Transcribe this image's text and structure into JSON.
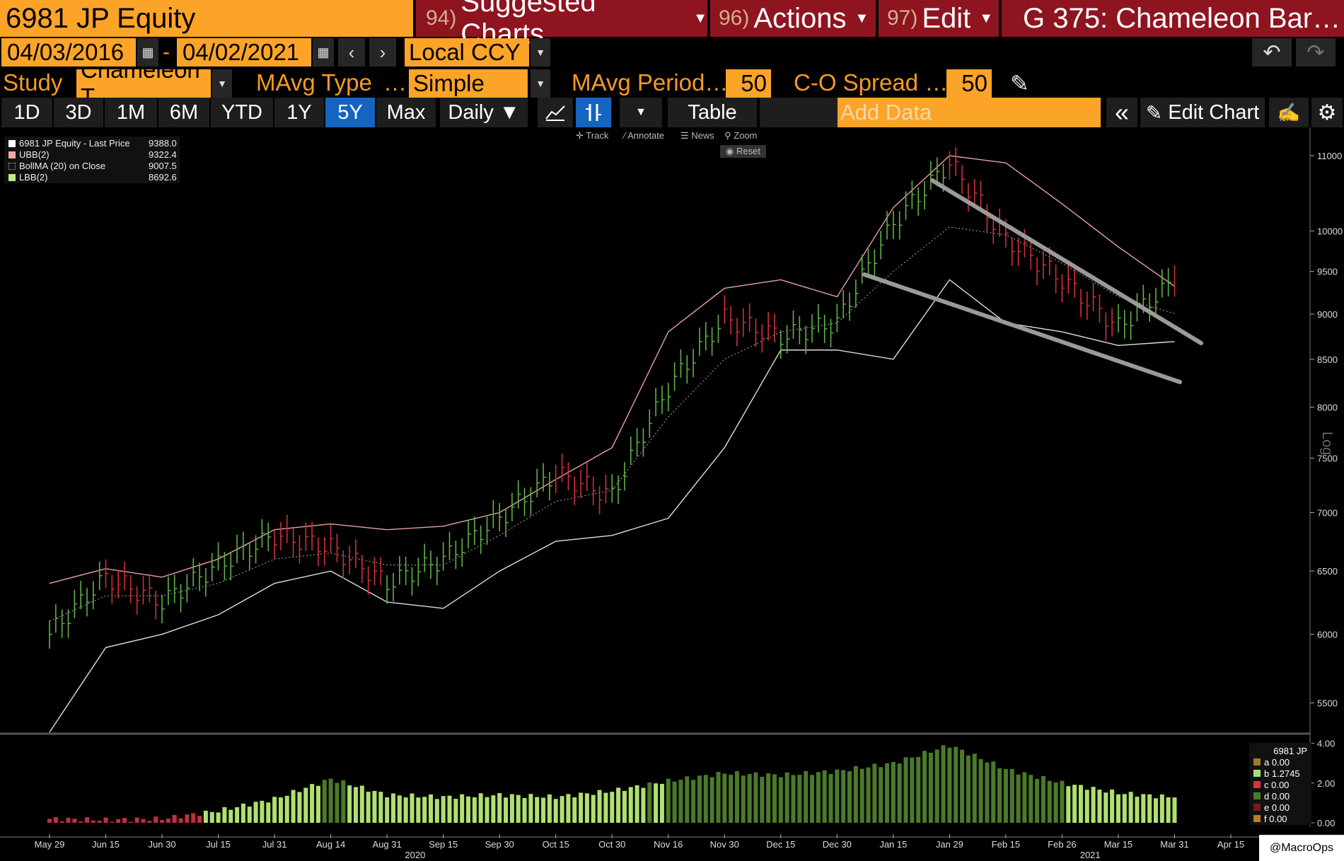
{
  "header": {
    "ticker": "6981 JP Equity",
    "menus": [
      {
        "num": "94)",
        "label": "Suggested Charts"
      },
      {
        "num": "96)",
        "label": "Actions"
      },
      {
        "num": "97)",
        "label": "Edit"
      }
    ],
    "window_title": "G 375: Chameleon Bar…"
  },
  "date_range": {
    "start": "04/03/2016",
    "separator": "-",
    "end": "04/02/2021",
    "currency": "Local CCY"
  },
  "study_bar": {
    "study_label": "Study",
    "study_value": "Chameleon T",
    "mavg_type_label": "MAvg Type",
    "mavg_type_ellipsis": "…",
    "mavg_type_value": "Simple",
    "mavg_period_label": "MAvg Period…",
    "mavg_period_value": "50",
    "co_spread_label": "C-O Spread …",
    "co_spread_value": "50"
  },
  "toolbar": {
    "periods": [
      "1D",
      "3D",
      "1M",
      "6M",
      "YTD",
      "1Y",
      "5Y",
      "Max"
    ],
    "selected_period": "5Y",
    "frequency": "Daily ▼",
    "table_label": "Table",
    "add_data_placeholder": "Add Data",
    "edit_chart_label": "Edit Chart",
    "subtools": [
      "Track",
      "Annotate",
      "News",
      "Zoom"
    ],
    "reset_label": "Reset"
  },
  "legend": [
    {
      "label": "6981 JP Equity - Last Price",
      "value": "9388.0",
      "color": "#ffffff"
    },
    {
      "label": "UBB(2)",
      "value": "9322.4",
      "color": "#f4a6a6"
    },
    {
      "label": "BollMA (20)  on Close",
      "value": "9007.5",
      "color": "#000000"
    },
    {
      "label": "LBB(2)",
      "value": "8692.6",
      "color": "#b4f08c"
    }
  ],
  "lower_legend": {
    "title": "6981 JP",
    "items": [
      {
        "key": "a",
        "value": "0.00",
        "color": "#a0782a"
      },
      {
        "key": "b",
        "value": "1.2745",
        "color": "#a8e070"
      },
      {
        "key": "c",
        "value": "0.00",
        "color": "#e03040"
      },
      {
        "key": "d",
        "value": "0.00",
        "color": "#4a7a2a"
      },
      {
        "key": "e",
        "value": "0.00",
        "color": "#7a1a22"
      },
      {
        "key": "f",
        "value": "0.00",
        "color": "#c07a2a"
      }
    ]
  },
  "watermark": "@MacroOps",
  "colors": {
    "orange": "#fba428",
    "dark_red": "#8e1420",
    "selected_blue": "#1565c0",
    "up_bar": "#5fb346",
    "down_bar": "#d0303a"
  },
  "chart_data": {
    "type": "line",
    "title": "",
    "scale": "log",
    "y_axis_label": "Log",
    "y_ticks": [
      11000,
      10000,
      9500,
      9000,
      8500,
      8000,
      7500,
      7000,
      6500,
      6000,
      5500
    ],
    "x_ticks": [
      "May 29",
      "Jun 15",
      "Jun 30",
      "Jul 15",
      "Jul 31",
      "Aug 14",
      "Aug 31",
      "Sep 15",
      "Sep 30",
      "Oct 15",
      "Oct 30",
      "Nov 16",
      "Nov 30",
      "Dec 15",
      "Dec 30",
      "Jan 15",
      "Jan 29",
      "Feb 15",
      "Feb 26",
      "Mar 15",
      "Mar 31",
      "Apr 15"
    ],
    "year_labels": [
      {
        "label": "2020",
        "after_tick": "Aug 31"
      },
      {
        "label": "2021",
        "after_tick": "Feb 26"
      }
    ],
    "grid": false,
    "legend_position": "top-left",
    "series": [
      {
        "name": "6981 JP Equity - Last Price",
        "x": [
          "May 29",
          "Jun 15",
          "Jun 30",
          "Jul 15",
          "Jul 31",
          "Aug 14",
          "Aug 31",
          "Sep 15",
          "Sep 30",
          "Oct 15",
          "Oct 30",
          "Nov 16",
          "Nov 30",
          "Dec 15",
          "Dec 30",
          "Jan 15",
          "Jan 29",
          "Feb 15",
          "Feb 26",
          "Mar 15",
          "Mar 31"
        ],
        "values": [
          6000,
          6450,
          6250,
          6550,
          6800,
          6700,
          6400,
          6600,
          6950,
          7350,
          7150,
          8200,
          8950,
          8750,
          8900,
          10100,
          10900,
          9900,
          9400,
          8850,
          9388
        ]
      },
      {
        "name": "UBB(2)",
        "x": [
          "May 29",
          "Jun 15",
          "Jun 30",
          "Jul 15",
          "Jul 31",
          "Aug 14",
          "Aug 31",
          "Sep 15",
          "Sep 30",
          "Oct 15",
          "Oct 30",
          "Nov 16",
          "Nov 30",
          "Dec 15",
          "Dec 30",
          "Jan 15",
          "Jan 29",
          "Feb 15",
          "Feb 26",
          "Mar 15",
          "Mar 31"
        ],
        "values": [
          6400,
          6520,
          6450,
          6600,
          6850,
          6900,
          6850,
          6880,
          7000,
          7300,
          7600,
          8800,
          9300,
          9400,
          9200,
          10300,
          11000,
          10900,
          10350,
          9800,
          9322.4
        ]
      },
      {
        "name": "BollMA (20)  on Close",
        "x": [
          "May 29",
          "Jun 15",
          "Jun 30",
          "Jul 15",
          "Jul 31",
          "Aug 14",
          "Aug 31",
          "Sep 15",
          "Sep 30",
          "Oct 15",
          "Oct 30",
          "Nov 16",
          "Nov 30",
          "Dec 15",
          "Dec 30",
          "Jan 15",
          "Jan 29",
          "Feb 15",
          "Feb 26",
          "Mar 15",
          "Mar 31"
        ],
        "values": [
          6100,
          6300,
          6300,
          6400,
          6600,
          6650,
          6550,
          6550,
          6800,
          7100,
          7200,
          7900,
          8500,
          8800,
          8900,
          9500,
          10050,
          9950,
          9600,
          9200,
          9007.5
        ]
      },
      {
        "name": "LBB(2)",
        "x": [
          "May 29",
          "Jun 15",
          "Jun 30",
          "Jul 15",
          "Jul 31",
          "Aug 14",
          "Aug 31",
          "Sep 15",
          "Sep 30",
          "Oct 15",
          "Oct 30",
          "Nov 16",
          "Nov 30",
          "Dec 15",
          "Dec 30",
          "Jan 15",
          "Jan 29",
          "Feb 15",
          "Feb 26",
          "Mar 15",
          "Mar 31"
        ],
        "values": [
          5300,
          5900,
          6000,
          6150,
          6400,
          6500,
          6250,
          6200,
          6500,
          6750,
          6800,
          6950,
          7600,
          8600,
          8600,
          8500,
          9400,
          8900,
          8800,
          8650,
          8692.6
        ]
      }
    ],
    "lower_panel": {
      "y_ticks": [
        4.0,
        2.0,
        0.0
      ],
      "x": [
        "May 29",
        "Jun 15",
        "Jun 30",
        "Jul 15",
        "Jul 31",
        "Aug 14",
        "Aug 31",
        "Sep 15",
        "Sep 30",
        "Oct 15",
        "Oct 30",
        "Nov 16",
        "Nov 30",
        "Dec 15",
        "Dec 30",
        "Jan 15",
        "Jan 29",
        "Feb 15",
        "Feb 26",
        "Mar 15",
        "Mar 31"
      ],
      "values": [
        0.2,
        0.15,
        0.2,
        0.6,
        1.2,
        2.2,
        1.4,
        1.3,
        1.4,
        1.3,
        1.6,
        2.1,
        2.5,
        2.4,
        2.6,
        3.0,
        3.9,
        2.7,
        2.0,
        1.5,
        1.2745
      ]
    }
  }
}
